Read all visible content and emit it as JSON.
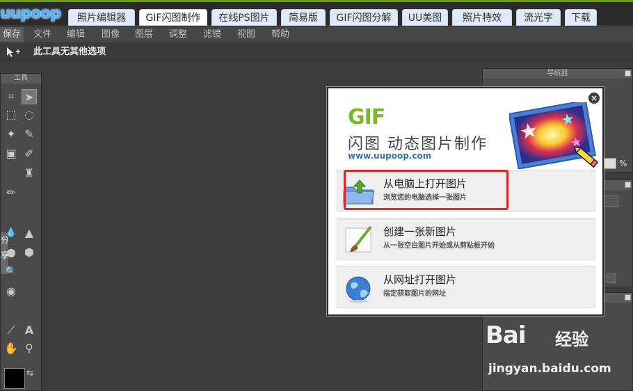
{
  "site": {
    "logo": "uupoop"
  },
  "nav": {
    "tabs": [
      {
        "label": "照片编辑器"
      },
      {
        "label": "GIF闪图制作"
      },
      {
        "label": "在线PS图片"
      },
      {
        "label": "简易版"
      },
      {
        "label": "GIF闪图分解"
      },
      {
        "label": "UU美图"
      },
      {
        "label": "照片特效"
      },
      {
        "label": "流光字"
      },
      {
        "label": "下载"
      }
    ],
    "active_tab": "GIF闪图制作"
  },
  "menubar": {
    "items": [
      {
        "label": "保存"
      },
      {
        "label": "文件"
      },
      {
        "label": "编辑"
      },
      {
        "label": "图像"
      },
      {
        "label": "图层"
      },
      {
        "label": "调整"
      },
      {
        "label": "滤镜"
      },
      {
        "label": "视图"
      },
      {
        "label": "帮助"
      }
    ]
  },
  "options_bar": {
    "text": "此工具无其他选项"
  },
  "tools": {
    "title": "工具",
    "side_tip": "分享",
    "items": [
      {
        "icon": "crop-icon",
        "glyph": "⌗"
      },
      {
        "icon": "move-icon",
        "glyph": "➤"
      },
      {
        "icon": "marquee-icon",
        "glyph": "⬚"
      },
      {
        "icon": "lasso-icon",
        "glyph": "◌"
      },
      {
        "icon": "magic-wand-icon",
        "glyph": "✦"
      },
      {
        "icon": "eraser-icon",
        "glyph": "✎"
      },
      {
        "icon": "gradient-icon",
        "glyph": "▣"
      },
      {
        "icon": "brush-icon",
        "glyph": "✐"
      },
      {
        "icon": "stamp-icon",
        "glyph": "♜"
      },
      {
        "icon": "pencil-icon",
        "glyph": "✏"
      },
      {
        "icon": "blur-icon",
        "glyph": "💧"
      },
      {
        "icon": "sharpen-icon",
        "glyph": "▲"
      },
      {
        "icon": "dodge-icon",
        "glyph": "●"
      },
      {
        "icon": "sponge-icon",
        "glyph": "⬢"
      },
      {
        "icon": "zoom-icon",
        "glyph": "🔍"
      },
      {
        "icon": "eye-icon",
        "glyph": "◉"
      },
      {
        "icon": "eyedropper-icon",
        "glyph": "⟋"
      },
      {
        "icon": "text-icon",
        "glyph": "A"
      },
      {
        "icon": "hand-icon",
        "glyph": "✋"
      },
      {
        "icon": "magnifier-icon",
        "glyph": "⚲"
      }
    ],
    "swap_glyph": "⇆"
  },
  "panels": {
    "navigator": {
      "title": "导航器",
      "zoom_suffix": "%"
    },
    "layers": {
      "title": ""
    },
    "history": {
      "title": ""
    }
  },
  "dialog": {
    "brand": "GIF",
    "title": "闪图  动态图片制作",
    "url": "www.uupoop.com",
    "close_glyph": "×",
    "options": [
      {
        "title": "从电脑上打开图片",
        "subtitle": "浏览您的电脑选择一张图片",
        "icon": "folder-upload-icon"
      },
      {
        "title": "创建一张新图片",
        "subtitle": "从一张空白图片开始或从剪贴板开始",
        "icon": "paintbrush-icon"
      },
      {
        "title": "从网址打开图片",
        "subtitle": "指定获取图片的网址",
        "icon": "globe-icon"
      }
    ]
  },
  "watermark": {
    "logo": "Bai",
    "brand": "经验",
    "url": "jingyan.baidu.com"
  }
}
